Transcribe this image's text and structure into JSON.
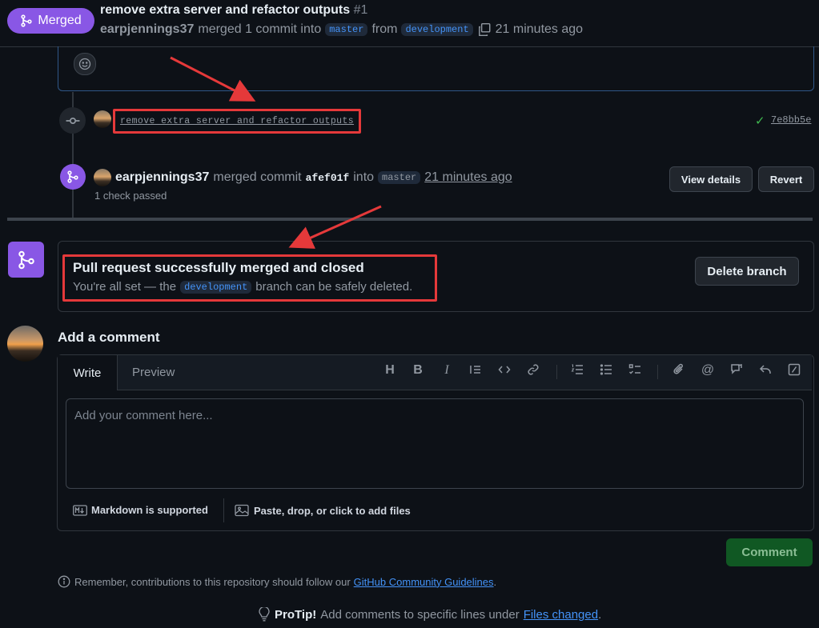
{
  "header": {
    "status_badge": "Merged",
    "title": "remove extra server and refactor outputs",
    "number": "#1",
    "author": "earpjennings37",
    "merged_text": "merged 1 commit into",
    "base_branch": "master",
    "from_text": "from",
    "head_branch": "development",
    "time": "21 minutes ago"
  },
  "timeline": {
    "commit": {
      "message": "remove extra server and refactor outputs",
      "sha": "7e8bb5e",
      "status": "success"
    },
    "merge_event": {
      "author": "earpjennings37",
      "action": "merged commit",
      "sha": "afef01f",
      "into_text": "into",
      "branch": "master",
      "time": "21 minutes ago",
      "checks": "1 check passed",
      "view_details_label": "View details",
      "revert_label": "Revert"
    }
  },
  "merge_status": {
    "title": "Pull request successfully merged and closed",
    "desc_prefix": "You're all set — the",
    "branch": "development",
    "desc_suffix": "branch can be safely deleted.",
    "delete_branch_label": "Delete branch"
  },
  "comment": {
    "heading": "Add a comment",
    "tabs": [
      "Write",
      "Preview"
    ],
    "placeholder": "Add your comment here...",
    "markdown_note": "Markdown is supported",
    "files_note": "Paste, drop, or click to add files",
    "submit_label": "Comment",
    "toolbar_icons": [
      "heading-icon",
      "bold-icon",
      "italic-icon",
      "quote-icon",
      "code-icon",
      "link-icon",
      "ordered-list-icon",
      "unordered-list-icon",
      "task-list-icon",
      "attach-icon",
      "mention-icon",
      "reference-icon",
      "reply-icon",
      "slash-command-icon"
    ]
  },
  "footer": {
    "remember_prefix": "Remember, contributions to this repository should follow our",
    "remember_link": "GitHub Community Guidelines",
    "remember_suffix": ".",
    "protip_label": "ProTip!",
    "protip_text": "Add comments to specific lines under",
    "protip_link": "Files changed",
    "protip_suffix": "."
  },
  "colors": {
    "background": "#0d1117",
    "merged_purple": "#8957e5",
    "annotation_red": "#e5393a",
    "success_green": "#3fb950",
    "link_blue": "#4493f8"
  }
}
